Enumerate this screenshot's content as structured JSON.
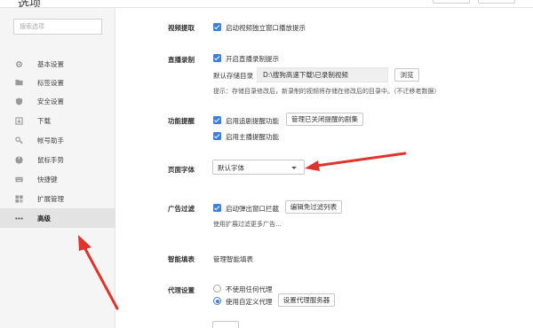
{
  "window": {
    "title": "选项"
  },
  "sidebar": {
    "search_placeholder": "搜索选项",
    "items": [
      {
        "label": "基本设置",
        "icon": "gear-icon"
      },
      {
        "label": "标签设置",
        "icon": "tab-icon"
      },
      {
        "label": "安全设置",
        "icon": "shield-icon"
      },
      {
        "label": "下载",
        "icon": "download-icon"
      },
      {
        "label": "帐号助手",
        "icon": "key-icon"
      },
      {
        "label": "鼠标手势",
        "icon": "mouse-icon"
      },
      {
        "label": "快捷键",
        "icon": "keyboard-icon"
      },
      {
        "label": "扩展管理",
        "icon": "extension-icon"
      },
      {
        "label": "高级",
        "icon": "more-icon",
        "active": true
      }
    ]
  },
  "video_pick": {
    "label": "视频提取",
    "option": "启动视频独立窗口播放提示"
  },
  "live_record": {
    "label": "直播录制",
    "option": "开启直播录制提示",
    "dir_label": "默认存储目录",
    "dir_value": "D:\\搜狗高速下载\\已录制视频",
    "browse_button": "浏览",
    "hint": "提示：存储目录修改后，新录制的视频将存储在修改后的目录中。（不迁移老数据）"
  },
  "feature_remind": {
    "label": "功能提醒",
    "option1": "启用追剧提醒功能",
    "manage_button": "管理已关闭提醒的剧集",
    "option2": "启用主播提醒功能"
  },
  "page_font": {
    "label": "页面字体",
    "value": "默认字体"
  },
  "ad_filter": {
    "label": "广告过滤",
    "option": "启动弹出窗口拦截",
    "edit_button": "编辑免过滤列表",
    "more": "使用扩展过滤更多广告..."
  },
  "smart_fill": {
    "label": "智能填表",
    "text": "管理智能填表"
  },
  "proxy": {
    "label": "代理设置",
    "option_none": "不使用任何代理",
    "option_custom": "使用自定义代理",
    "setup_button": "设置代理服务器"
  },
  "colors": {
    "accent": "#3d7fe0",
    "arrow": "#e0332b",
    "sidebar_bg": "#f5f5f5"
  }
}
